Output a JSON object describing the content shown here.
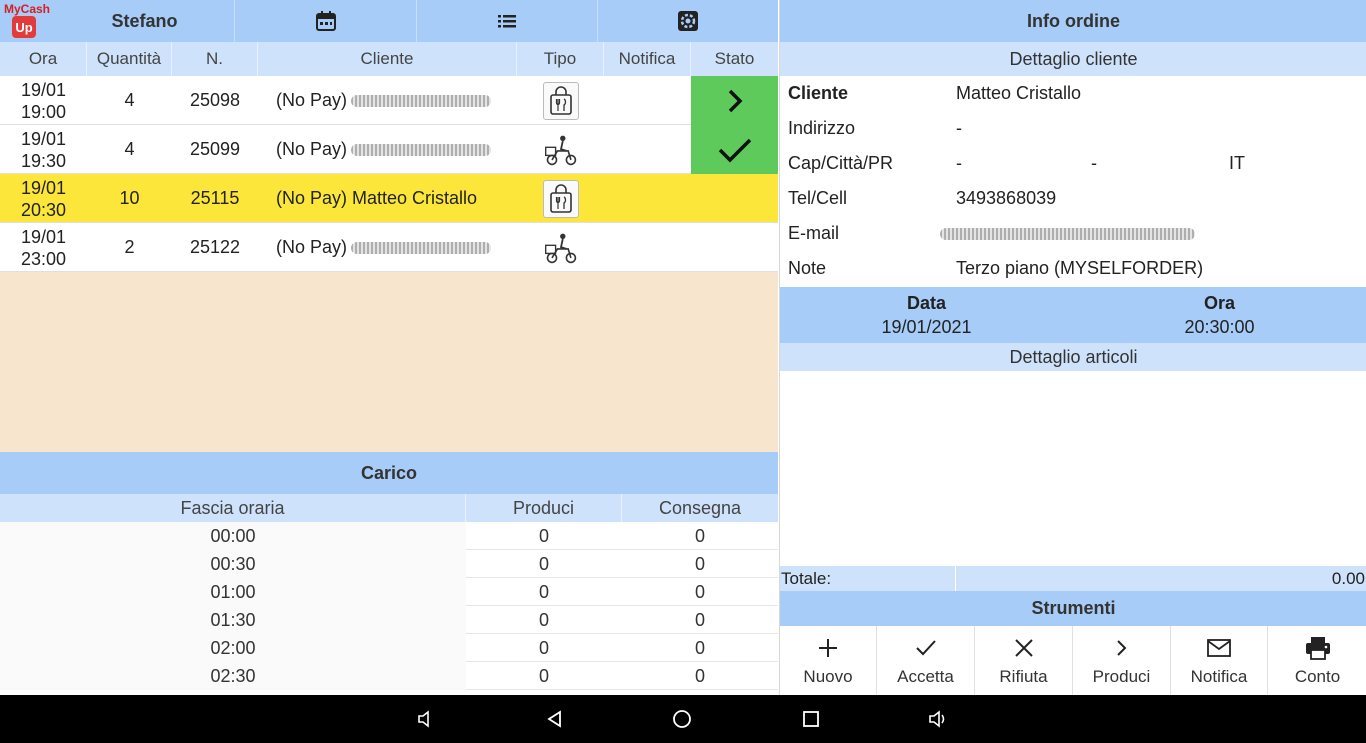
{
  "app": {
    "logo_top": "MyCash",
    "logo_badge": "Up",
    "user": "Stefano"
  },
  "topbar_icons": [
    "calendar-icon",
    "list-icon",
    "settings-icon"
  ],
  "orders": {
    "headers": [
      "Ora",
      "Quantità",
      "N.",
      "Cliente",
      "Tipo",
      "Notifica",
      "Stato"
    ],
    "rows": [
      {
        "date": "19/01",
        "time": "19:00",
        "qty": "4",
        "num": "25098",
        "client": "(No Pay)",
        "tipo": "takeaway-bag-icon",
        "stato": "chevron-right-icon",
        "selected": false
      },
      {
        "date": "19/01",
        "time": "19:30",
        "qty": "4",
        "num": "25099",
        "client": "(No Pay)",
        "tipo": "delivery-scooter-icon",
        "stato": "check-icon",
        "selected": false
      },
      {
        "date": "19/01",
        "time": "20:30",
        "qty": "10",
        "num": "25115",
        "client": "(No Pay) Matteo  Cristallo",
        "tipo": "takeaway-bag-icon",
        "stato": "",
        "selected": true
      },
      {
        "date": "19/01",
        "time": "23:00",
        "qty": "2",
        "num": "25122",
        "client": "(No Pay)",
        "tipo": "delivery-scooter-icon",
        "stato": "",
        "selected": false
      }
    ]
  },
  "carico": {
    "title": "Carico",
    "headers": [
      "Fascia oraria",
      "Produci",
      "Consegna"
    ],
    "rows": [
      [
        "00:00",
        "0",
        "0"
      ],
      [
        "00:30",
        "0",
        "0"
      ],
      [
        "01:00",
        "0",
        "0"
      ],
      [
        "01:30",
        "0",
        "0"
      ],
      [
        "02:00",
        "0",
        "0"
      ],
      [
        "02:30",
        "0",
        "0"
      ]
    ]
  },
  "info": {
    "title": "Info ordine",
    "detail_title": "Dettaglio cliente",
    "cliente_label": "Cliente",
    "cliente": "Matteo Cristallo",
    "indirizzo_label": "Indirizzo",
    "indirizzo": "-",
    "cap_label": "Cap/Città/PR",
    "cap": "-",
    "citta": "-",
    "pr": "IT",
    "tel_label": "Tel/Cell",
    "tel": "3493868039",
    "email_label": "E-mail",
    "note_label": "Note",
    "note": "Terzo piano (MYSELFORDER)",
    "data_label": "Data",
    "data": "19/01/2021",
    "ora_label": "Ora",
    "ora": "20:30:00",
    "articoli_title": "Dettaglio articoli",
    "totale_label": "Totale:",
    "totale": "0.00",
    "strumenti_title": "Strumenti"
  },
  "tools": [
    {
      "label": "Nuovo",
      "icon": "plus-icon"
    },
    {
      "label": "Accetta",
      "icon": "check-icon"
    },
    {
      "label": "Rifiuta",
      "icon": "close-icon"
    },
    {
      "label": "Produci",
      "icon": "chevron-right-icon"
    },
    {
      "label": "Notifica",
      "icon": "mail-icon"
    },
    {
      "label": "Conto",
      "icon": "printer-icon"
    }
  ],
  "colors": {
    "header": "#a6ccf7",
    "subheader": "#cfe2fb",
    "selected_row": "#fde63a",
    "status_green": "#5fca5c",
    "background": "#f7e6cd"
  }
}
